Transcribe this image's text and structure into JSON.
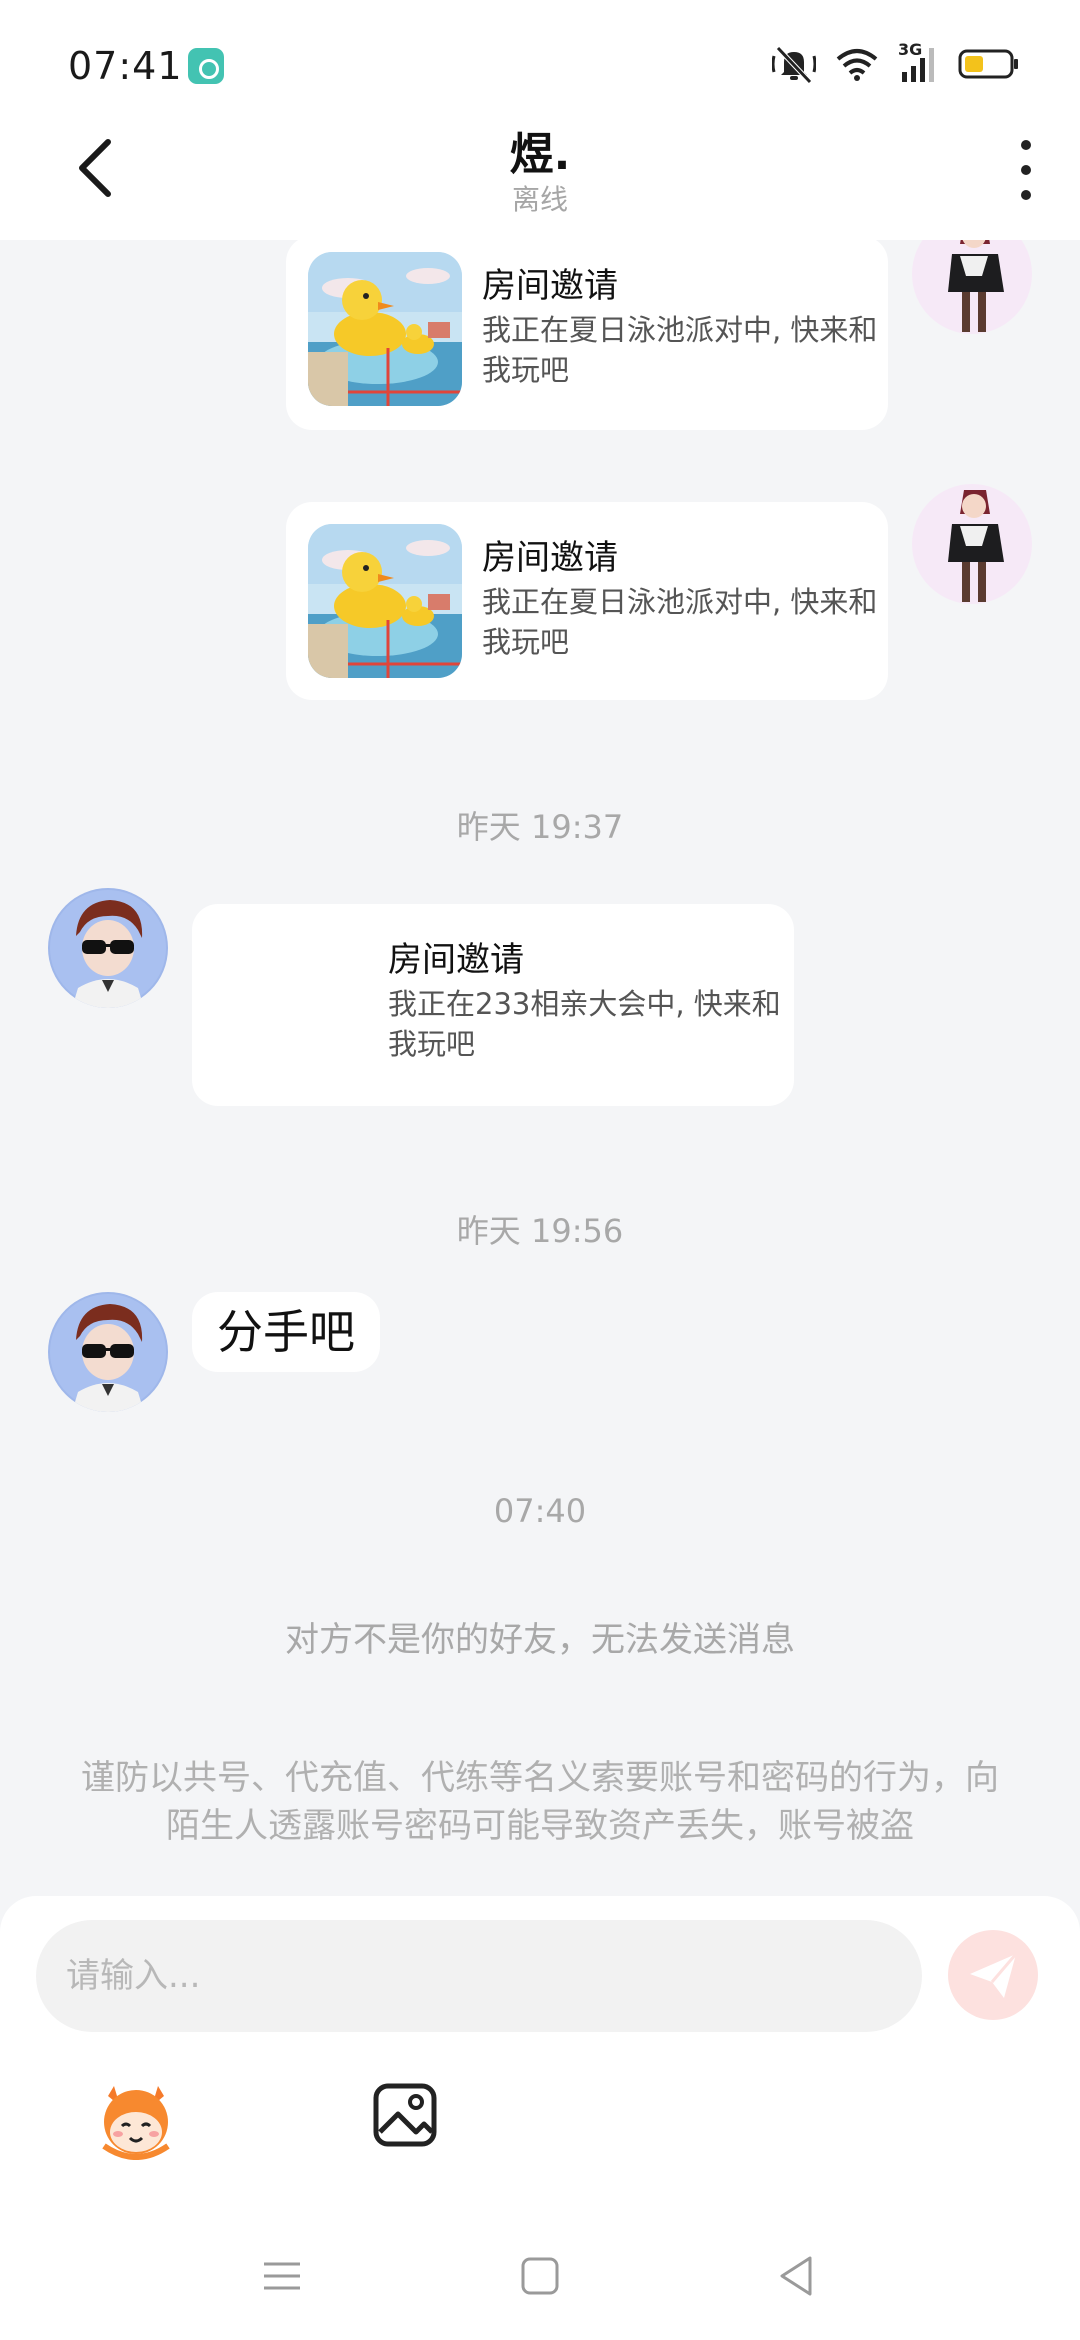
{
  "status_bar": {
    "time": "07:41",
    "network_label": "3G",
    "icons": [
      "app-notification-icon",
      "mute-bell-icon",
      "wifi-icon",
      "signal-icon",
      "battery-icon"
    ]
  },
  "header": {
    "title": "煜.",
    "subtitle": "离线",
    "back_icon": "chevron-left-icon",
    "more_icon": "more-vertical-icon"
  },
  "messages": [
    {
      "type": "invite",
      "side": "right",
      "title": "房间邀请",
      "desc": "我正在夏日泳池派对中, 快来和我玩吧"
    },
    {
      "type": "invite",
      "side": "right",
      "title": "房间邀请",
      "desc": "我正在夏日泳池派对中, 快来和我玩吧"
    },
    {
      "type": "timestamp",
      "text": "昨天 19:37"
    },
    {
      "type": "invite",
      "side": "left",
      "title": "房间邀请",
      "desc": "我正在233相亲大会中, 快来和我玩吧"
    },
    {
      "type": "timestamp",
      "text": "昨天 19:56"
    },
    {
      "type": "text",
      "side": "left",
      "text": "分手吧"
    },
    {
      "type": "timestamp",
      "text": "07:40"
    },
    {
      "type": "system",
      "text": "对方不是你的好友，无法发送消息"
    }
  ],
  "warning": "谨防以共号、代充值、代练等名义索要账号和密码的行为，向陌生人透露账号密码可能导致资产丢失，账号被盗",
  "input": {
    "placeholder": "请输入...",
    "send_icon": "send-icon"
  },
  "toolbar": {
    "emoji_icon": "emoji-avatar-icon",
    "image_icon": "image-icon"
  },
  "nav_bar": {
    "icons": [
      "menu-icon",
      "home-icon",
      "back-icon"
    ]
  },
  "colors": {
    "background": "#f4f5f7",
    "bubble": "#ffffff",
    "send_button": "#fde1df",
    "send_icon": "#ffffff"
  }
}
